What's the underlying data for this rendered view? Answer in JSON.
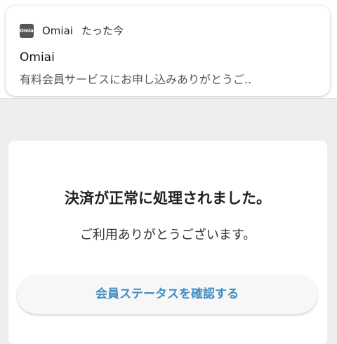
{
  "notification": {
    "app_icon_text": "Omiai",
    "app_name": "Omiai",
    "time": "たった今",
    "title": "Omiai",
    "body": "有料会員サービスにお申し込みありがとうご.."
  },
  "card": {
    "title": "決済が正常に処理されました。",
    "message": "ご利用ありがとうございます。",
    "button_label": "会員ステータスを確認する"
  },
  "colors": {
    "accent": "#3f8fc4",
    "background": "#eeeeee",
    "card": "#ffffff"
  }
}
